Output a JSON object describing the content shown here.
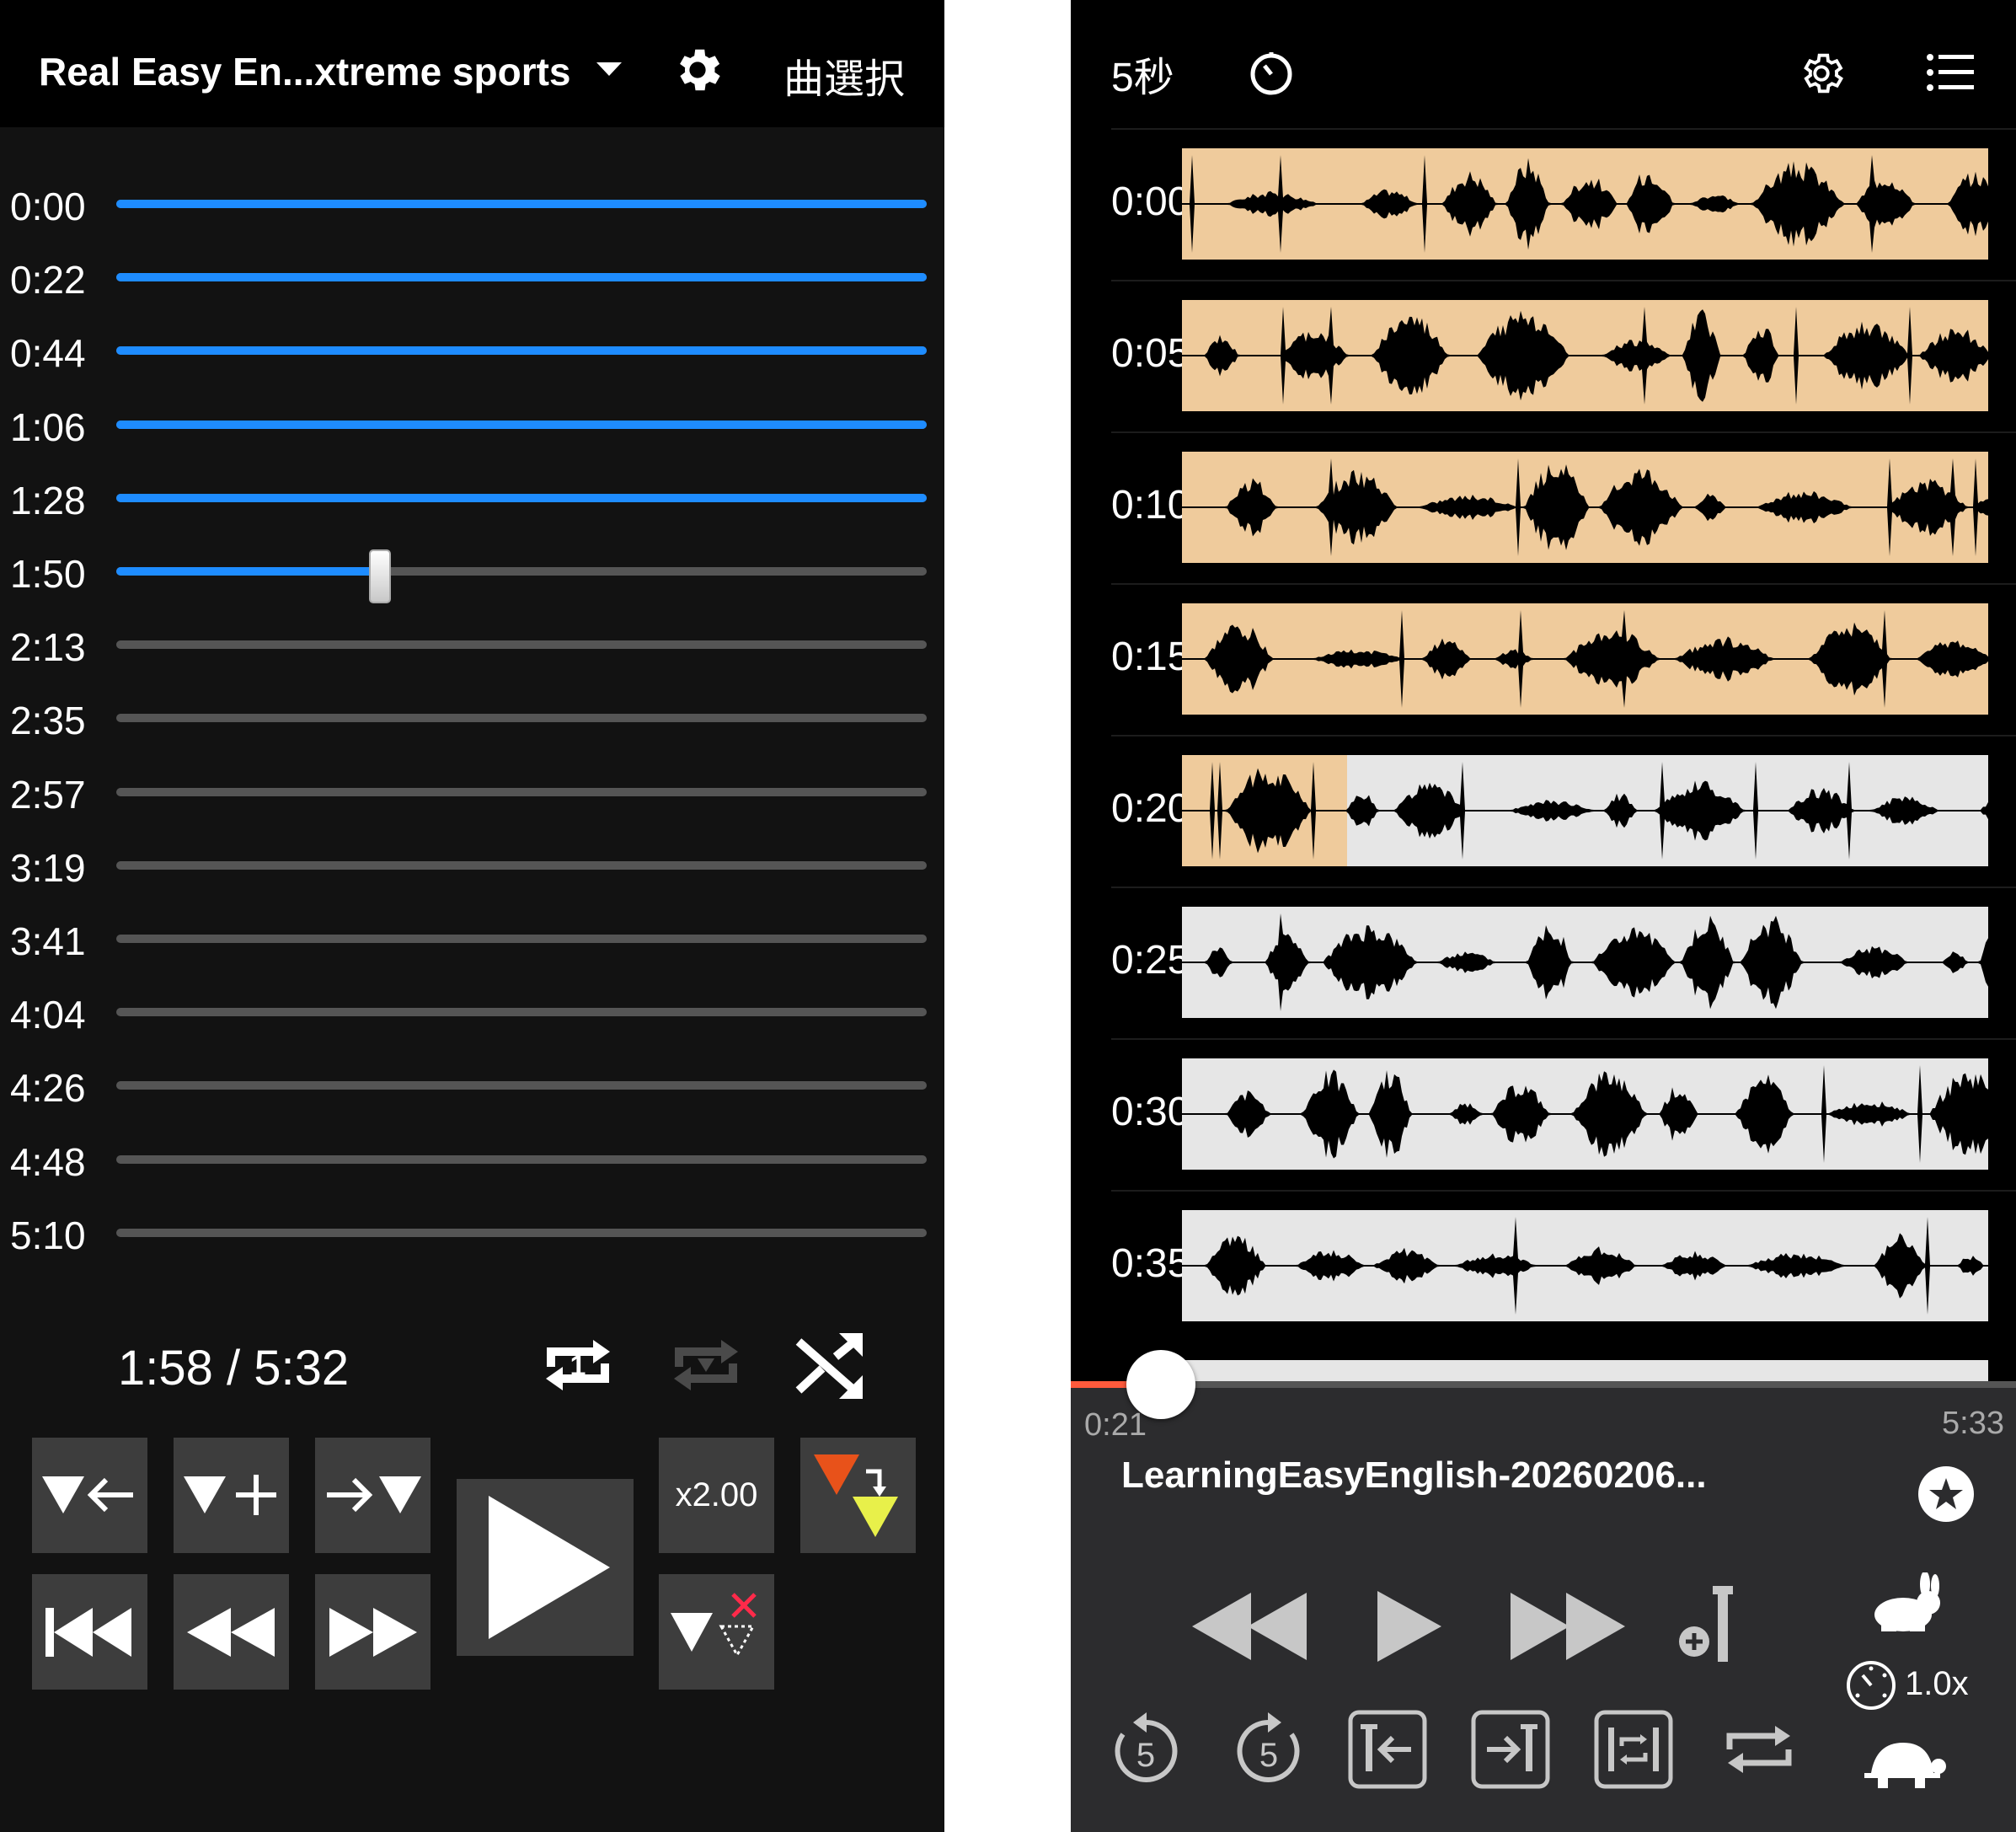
{
  "left_app": {
    "title": "Real Easy En...xtreme sports",
    "song_select": "曲選択",
    "tracks": [
      {
        "time": "0:00",
        "progress": 1.0
      },
      {
        "time": "0:22",
        "progress": 1.0
      },
      {
        "time": "0:44",
        "progress": 1.0
      },
      {
        "time": "1:06",
        "progress": 1.0
      },
      {
        "time": "1:28",
        "progress": 1.0
      },
      {
        "time": "1:50",
        "progress": 0.325
      },
      {
        "time": "2:13",
        "progress": 0
      },
      {
        "time": "2:35",
        "progress": 0
      },
      {
        "time": "2:57",
        "progress": 0
      },
      {
        "time": "3:19",
        "progress": 0
      },
      {
        "time": "3:41",
        "progress": 0
      },
      {
        "time": "4:04",
        "progress": 0
      },
      {
        "time": "4:26",
        "progress": 0
      },
      {
        "time": "4:48",
        "progress": 0
      },
      {
        "time": "5:10",
        "progress": 0
      }
    ],
    "position": "1:58 / 5:32",
    "speed_label": "x2.00",
    "colors": {
      "accent": "#1e8cff",
      "button_bg": "#3d3d3d",
      "marker_orange": "#e8521a",
      "marker_yellow": "#e8f04a",
      "delete_red": "#ff2a4a"
    }
  },
  "right_app": {
    "interval": "5秒",
    "waveform_rows": [
      {
        "time": "0:00",
        "played": 1.0
      },
      {
        "time": "0:05",
        "played": 1.0
      },
      {
        "time": "0:10",
        "played": 1.0
      },
      {
        "time": "0:15",
        "played": 1.0
      },
      {
        "time": "0:20",
        "played": 0.205
      },
      {
        "time": "0:25",
        "played": 0
      },
      {
        "time": "0:30",
        "played": 0
      },
      {
        "time": "0:35",
        "played": 0
      }
    ],
    "current_time": "0:21",
    "total_time": "5:33",
    "seek_progress": 0.063,
    "track_title": "LearningEasyEnglish-20260206...",
    "speed": "1.0x",
    "skip_seconds": "5",
    "colors": {
      "played": "#efcb9c",
      "unplayed": "#e6e6e6",
      "seek": "#ff5a3c",
      "panel": "#2c2c2e"
    }
  }
}
